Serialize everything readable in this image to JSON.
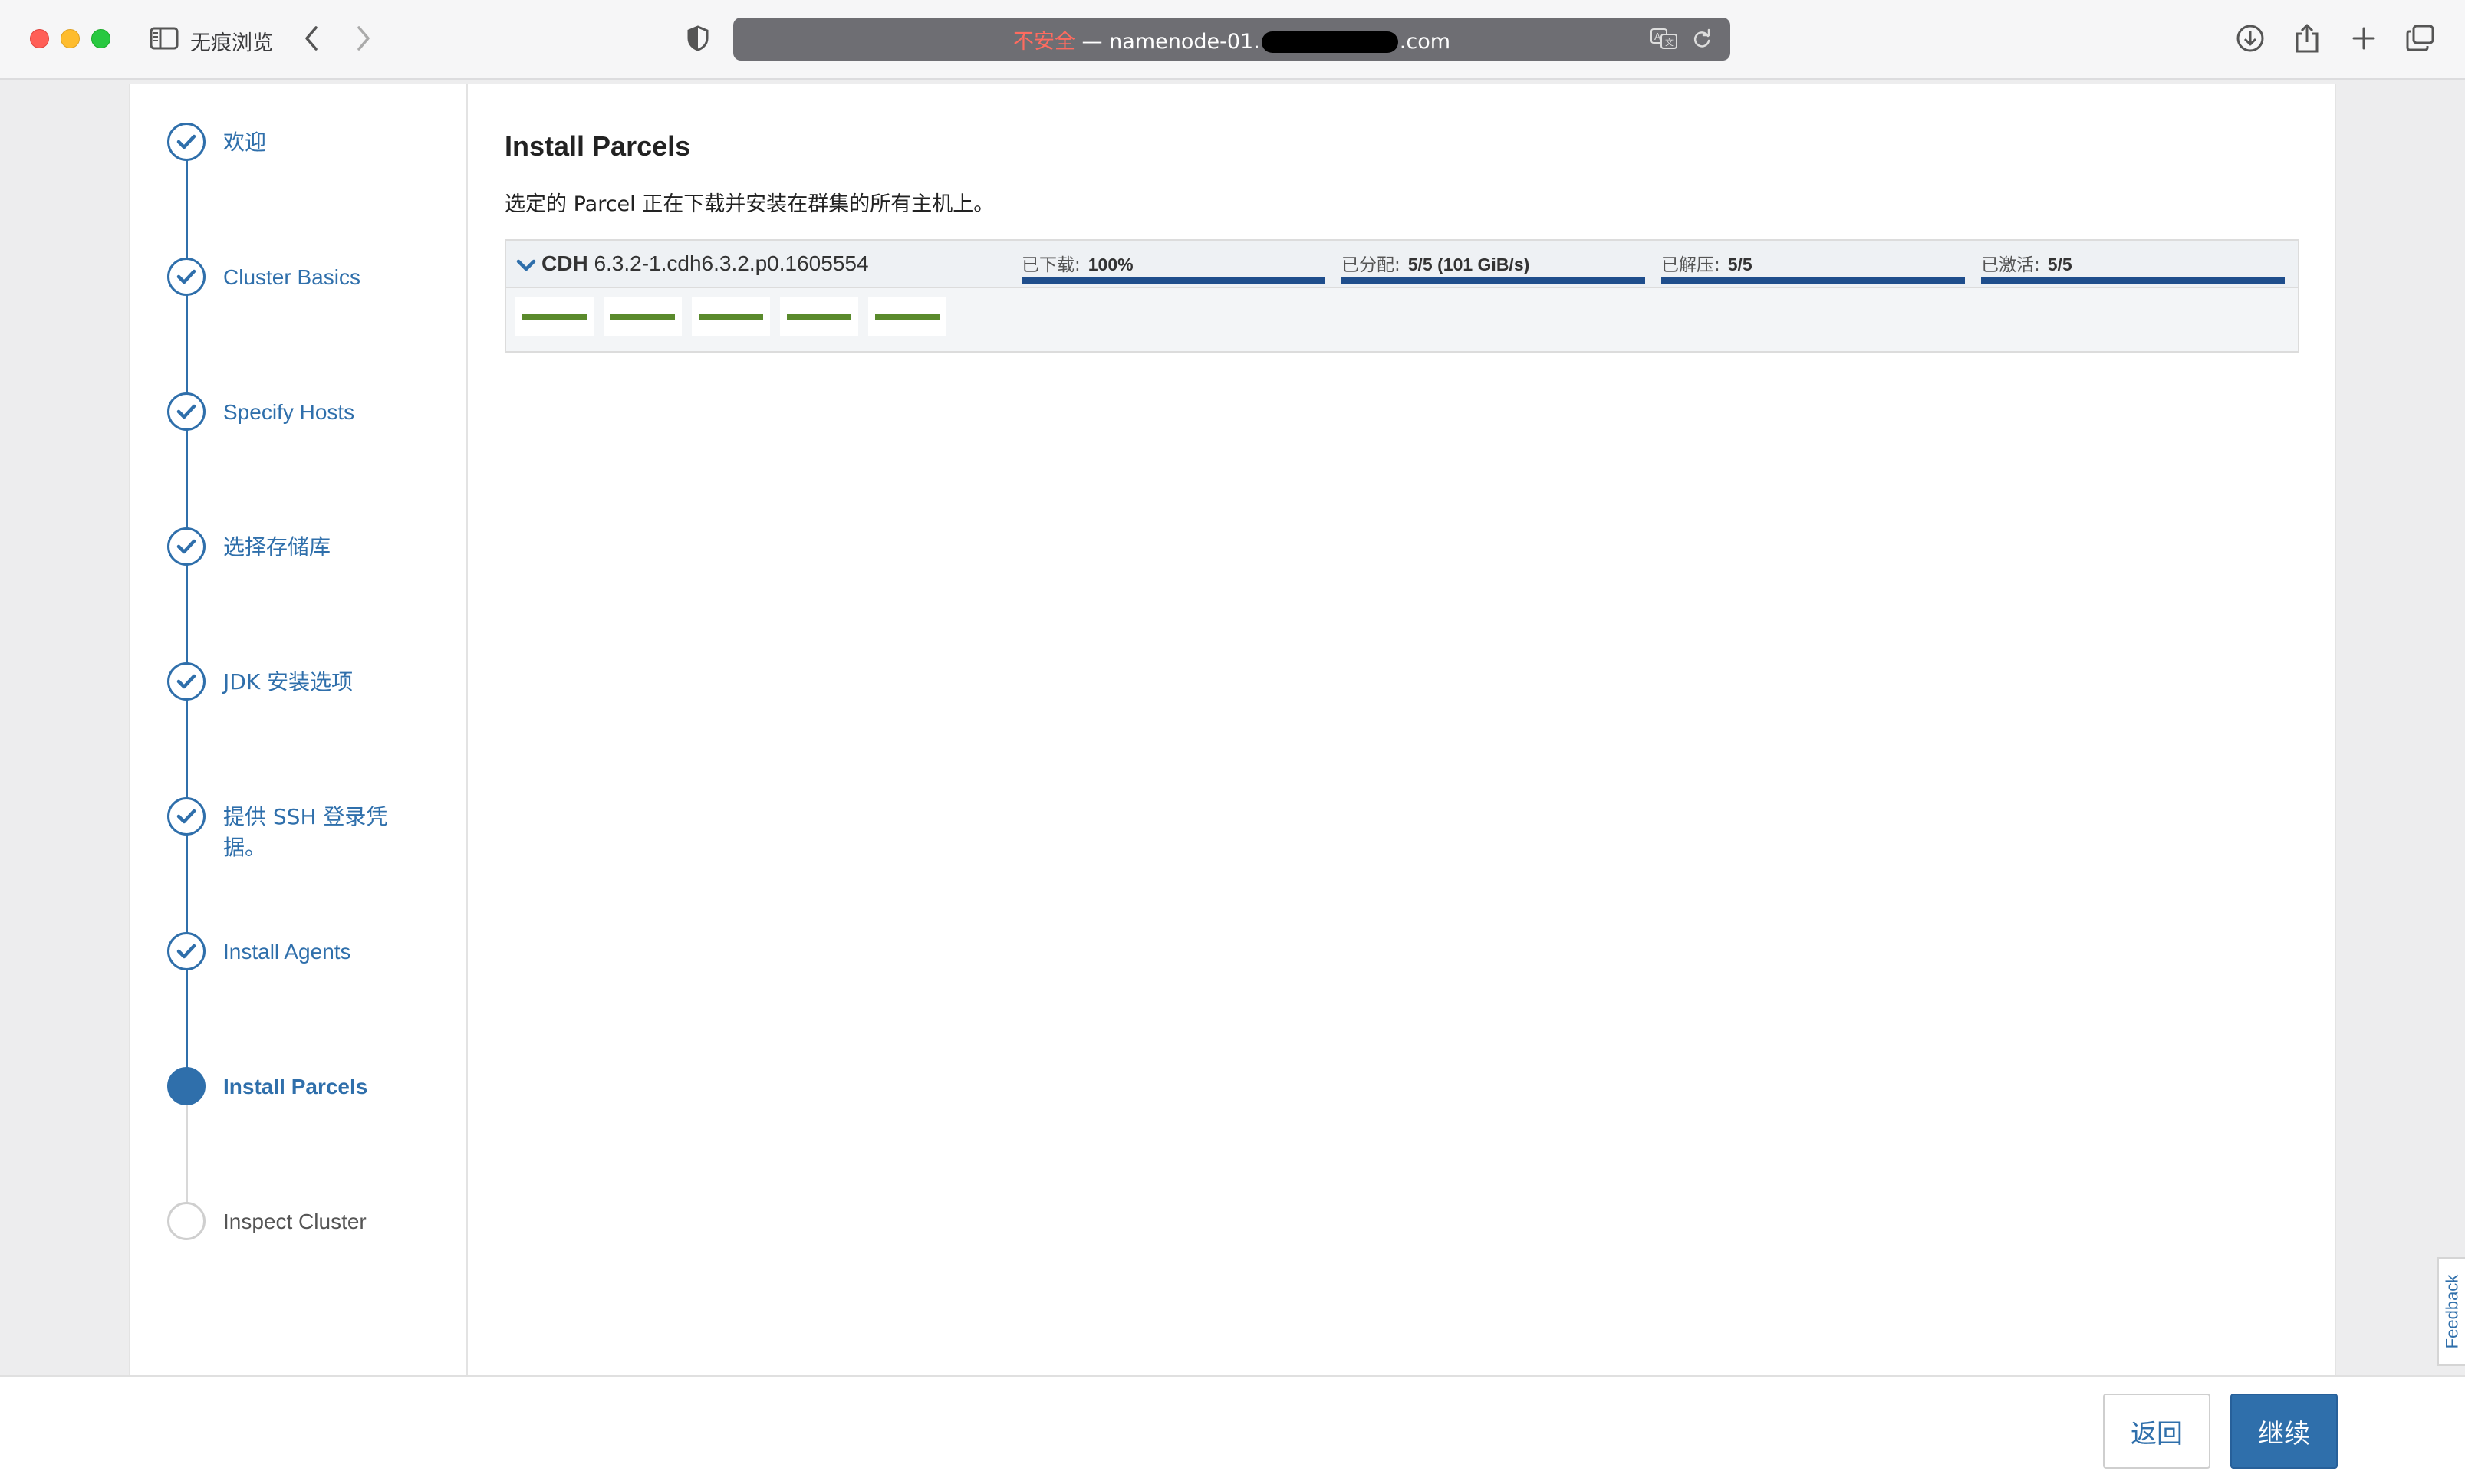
{
  "browser": {
    "private_label": "无痕浏览",
    "address_insecure": "不安全",
    "address_sep": " — ",
    "address_host_start": "namenode-01.",
    "address_host_end": ".com"
  },
  "wizard": {
    "steps": [
      {
        "label": "欢迎",
        "state": "done"
      },
      {
        "label": "Cluster Basics",
        "state": "done"
      },
      {
        "label": "Specify Hosts",
        "state": "done"
      },
      {
        "label": "选择存储库",
        "state": "done"
      },
      {
        "label": "JDK 安装选项",
        "state": "done"
      },
      {
        "label": "提供 SSH 登录凭据。",
        "state": "done"
      },
      {
        "label": "Install Agents",
        "state": "done"
      },
      {
        "label": "Install Parcels",
        "state": "active"
      },
      {
        "label": "Inspect Cluster",
        "state": "pending"
      }
    ]
  },
  "main": {
    "title": "Install Parcels",
    "description": "选定的 Parcel 正在下载并安装在群集的所有主机上。",
    "parcel": {
      "name": "CDH",
      "version": " 6.3.2-1.cdh6.3.2.p0.1605554",
      "stats": [
        {
          "label": "已下载:",
          "value": "100%",
          "progress": 1.0
        },
        {
          "label": "已分配:",
          "value": "5/5 (101 GiB/s)",
          "progress": 1.0
        },
        {
          "label": "已解压:",
          "value": "5/5",
          "progress": 1.0
        },
        {
          "label": "已激活:",
          "value": "5/5",
          "progress": 1.0
        }
      ],
      "host_count": 5,
      "host_status_color": "#5a8a2c"
    }
  },
  "feedback_label": "Feedback",
  "footer": {
    "back_label": "返回",
    "next_label": "继续"
  },
  "colors": {
    "accent": "#2f6fab",
    "progress": "#1f4e8c",
    "host_ok": "#5a8a2c"
  }
}
